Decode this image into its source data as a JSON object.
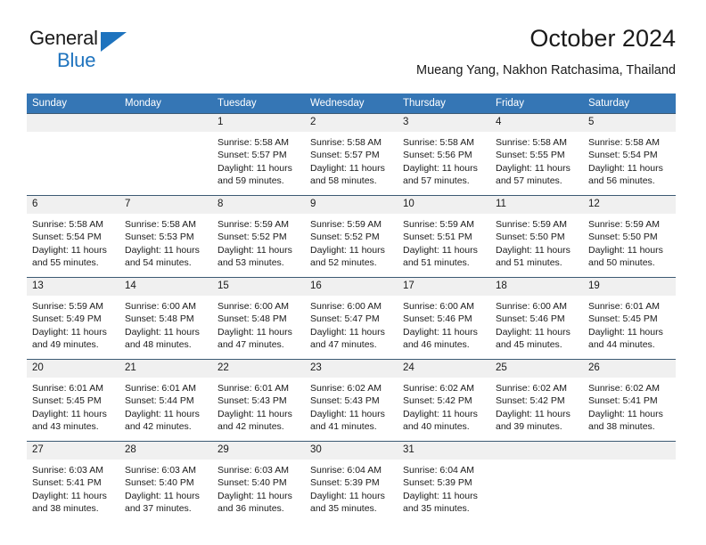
{
  "logo": {
    "word1": "General",
    "word2": "Blue",
    "triangle_color": "#1e73be"
  },
  "header": {
    "title": "October 2024",
    "subtitle": "Mueang Yang, Nakhon Ratchasima, Thailand",
    "header_bg": "#3576b5"
  },
  "calendar": {
    "weekday_headers": [
      "Sunday",
      "Monday",
      "Tuesday",
      "Wednesday",
      "Thursday",
      "Friday",
      "Saturday"
    ],
    "labels": {
      "sunrise": "Sunrise:",
      "sunset": "Sunset:",
      "daylight": "Daylight:"
    },
    "weeks": [
      [
        {
          "day": "",
          "empty": true
        },
        {
          "day": "",
          "empty": true
        },
        {
          "day": "1",
          "sunrise": "Sunrise: 5:58 AM",
          "sunset": "Sunset: 5:57 PM",
          "daylight_1": "Daylight: 11 hours",
          "daylight_2": "and 59 minutes."
        },
        {
          "day": "2",
          "sunrise": "Sunrise: 5:58 AM",
          "sunset": "Sunset: 5:57 PM",
          "daylight_1": "Daylight: 11 hours",
          "daylight_2": "and 58 minutes."
        },
        {
          "day": "3",
          "sunrise": "Sunrise: 5:58 AM",
          "sunset": "Sunset: 5:56 PM",
          "daylight_1": "Daylight: 11 hours",
          "daylight_2": "and 57 minutes."
        },
        {
          "day": "4",
          "sunrise": "Sunrise: 5:58 AM",
          "sunset": "Sunset: 5:55 PM",
          "daylight_1": "Daylight: 11 hours",
          "daylight_2": "and 57 minutes."
        },
        {
          "day": "5",
          "sunrise": "Sunrise: 5:58 AM",
          "sunset": "Sunset: 5:54 PM",
          "daylight_1": "Daylight: 11 hours",
          "daylight_2": "and 56 minutes."
        }
      ],
      [
        {
          "day": "6",
          "sunrise": "Sunrise: 5:58 AM",
          "sunset": "Sunset: 5:54 PM",
          "daylight_1": "Daylight: 11 hours",
          "daylight_2": "and 55 minutes."
        },
        {
          "day": "7",
          "sunrise": "Sunrise: 5:58 AM",
          "sunset": "Sunset: 5:53 PM",
          "daylight_1": "Daylight: 11 hours",
          "daylight_2": "and 54 minutes."
        },
        {
          "day": "8",
          "sunrise": "Sunrise: 5:59 AM",
          "sunset": "Sunset: 5:52 PM",
          "daylight_1": "Daylight: 11 hours",
          "daylight_2": "and 53 minutes."
        },
        {
          "day": "9",
          "sunrise": "Sunrise: 5:59 AM",
          "sunset": "Sunset: 5:52 PM",
          "daylight_1": "Daylight: 11 hours",
          "daylight_2": "and 52 minutes."
        },
        {
          "day": "10",
          "sunrise": "Sunrise: 5:59 AM",
          "sunset": "Sunset: 5:51 PM",
          "daylight_1": "Daylight: 11 hours",
          "daylight_2": "and 51 minutes."
        },
        {
          "day": "11",
          "sunrise": "Sunrise: 5:59 AM",
          "sunset": "Sunset: 5:50 PM",
          "daylight_1": "Daylight: 11 hours",
          "daylight_2": "and 51 minutes."
        },
        {
          "day": "12",
          "sunrise": "Sunrise: 5:59 AM",
          "sunset": "Sunset: 5:50 PM",
          "daylight_1": "Daylight: 11 hours",
          "daylight_2": "and 50 minutes."
        }
      ],
      [
        {
          "day": "13",
          "sunrise": "Sunrise: 5:59 AM",
          "sunset": "Sunset: 5:49 PM",
          "daylight_1": "Daylight: 11 hours",
          "daylight_2": "and 49 minutes."
        },
        {
          "day": "14",
          "sunrise": "Sunrise: 6:00 AM",
          "sunset": "Sunset: 5:48 PM",
          "daylight_1": "Daylight: 11 hours",
          "daylight_2": "and 48 minutes."
        },
        {
          "day": "15",
          "sunrise": "Sunrise: 6:00 AM",
          "sunset": "Sunset: 5:48 PM",
          "daylight_1": "Daylight: 11 hours",
          "daylight_2": "and 47 minutes."
        },
        {
          "day": "16",
          "sunrise": "Sunrise: 6:00 AM",
          "sunset": "Sunset: 5:47 PM",
          "daylight_1": "Daylight: 11 hours",
          "daylight_2": "and 47 minutes."
        },
        {
          "day": "17",
          "sunrise": "Sunrise: 6:00 AM",
          "sunset": "Sunset: 5:46 PM",
          "daylight_1": "Daylight: 11 hours",
          "daylight_2": "and 46 minutes."
        },
        {
          "day": "18",
          "sunrise": "Sunrise: 6:00 AM",
          "sunset": "Sunset: 5:46 PM",
          "daylight_1": "Daylight: 11 hours",
          "daylight_2": "and 45 minutes."
        },
        {
          "day": "19",
          "sunrise": "Sunrise: 6:01 AM",
          "sunset": "Sunset: 5:45 PM",
          "daylight_1": "Daylight: 11 hours",
          "daylight_2": "and 44 minutes."
        }
      ],
      [
        {
          "day": "20",
          "sunrise": "Sunrise: 6:01 AM",
          "sunset": "Sunset: 5:45 PM",
          "daylight_1": "Daylight: 11 hours",
          "daylight_2": "and 43 minutes."
        },
        {
          "day": "21",
          "sunrise": "Sunrise: 6:01 AM",
          "sunset": "Sunset: 5:44 PM",
          "daylight_1": "Daylight: 11 hours",
          "daylight_2": "and 42 minutes."
        },
        {
          "day": "22",
          "sunrise": "Sunrise: 6:01 AM",
          "sunset": "Sunset: 5:43 PM",
          "daylight_1": "Daylight: 11 hours",
          "daylight_2": "and 42 minutes."
        },
        {
          "day": "23",
          "sunrise": "Sunrise: 6:02 AM",
          "sunset": "Sunset: 5:43 PM",
          "daylight_1": "Daylight: 11 hours",
          "daylight_2": "and 41 minutes."
        },
        {
          "day": "24",
          "sunrise": "Sunrise: 6:02 AM",
          "sunset": "Sunset: 5:42 PM",
          "daylight_1": "Daylight: 11 hours",
          "daylight_2": "and 40 minutes."
        },
        {
          "day": "25",
          "sunrise": "Sunrise: 6:02 AM",
          "sunset": "Sunset: 5:42 PM",
          "daylight_1": "Daylight: 11 hours",
          "daylight_2": "and 39 minutes."
        },
        {
          "day": "26",
          "sunrise": "Sunrise: 6:02 AM",
          "sunset": "Sunset: 5:41 PM",
          "daylight_1": "Daylight: 11 hours",
          "daylight_2": "and 38 minutes."
        }
      ],
      [
        {
          "day": "27",
          "sunrise": "Sunrise: 6:03 AM",
          "sunset": "Sunset: 5:41 PM",
          "daylight_1": "Daylight: 11 hours",
          "daylight_2": "and 38 minutes."
        },
        {
          "day": "28",
          "sunrise": "Sunrise: 6:03 AM",
          "sunset": "Sunset: 5:40 PM",
          "daylight_1": "Daylight: 11 hours",
          "daylight_2": "and 37 minutes."
        },
        {
          "day": "29",
          "sunrise": "Sunrise: 6:03 AM",
          "sunset": "Sunset: 5:40 PM",
          "daylight_1": "Daylight: 11 hours",
          "daylight_2": "and 36 minutes."
        },
        {
          "day": "30",
          "sunrise": "Sunrise: 6:04 AM",
          "sunset": "Sunset: 5:39 PM",
          "daylight_1": "Daylight: 11 hours",
          "daylight_2": "and 35 minutes."
        },
        {
          "day": "31",
          "sunrise": "Sunrise: 6:04 AM",
          "sunset": "Sunset: 5:39 PM",
          "daylight_1": "Daylight: 11 hours",
          "daylight_2": "and 35 minutes."
        },
        {
          "day": "",
          "empty": true
        },
        {
          "day": "",
          "empty": true
        }
      ]
    ]
  }
}
